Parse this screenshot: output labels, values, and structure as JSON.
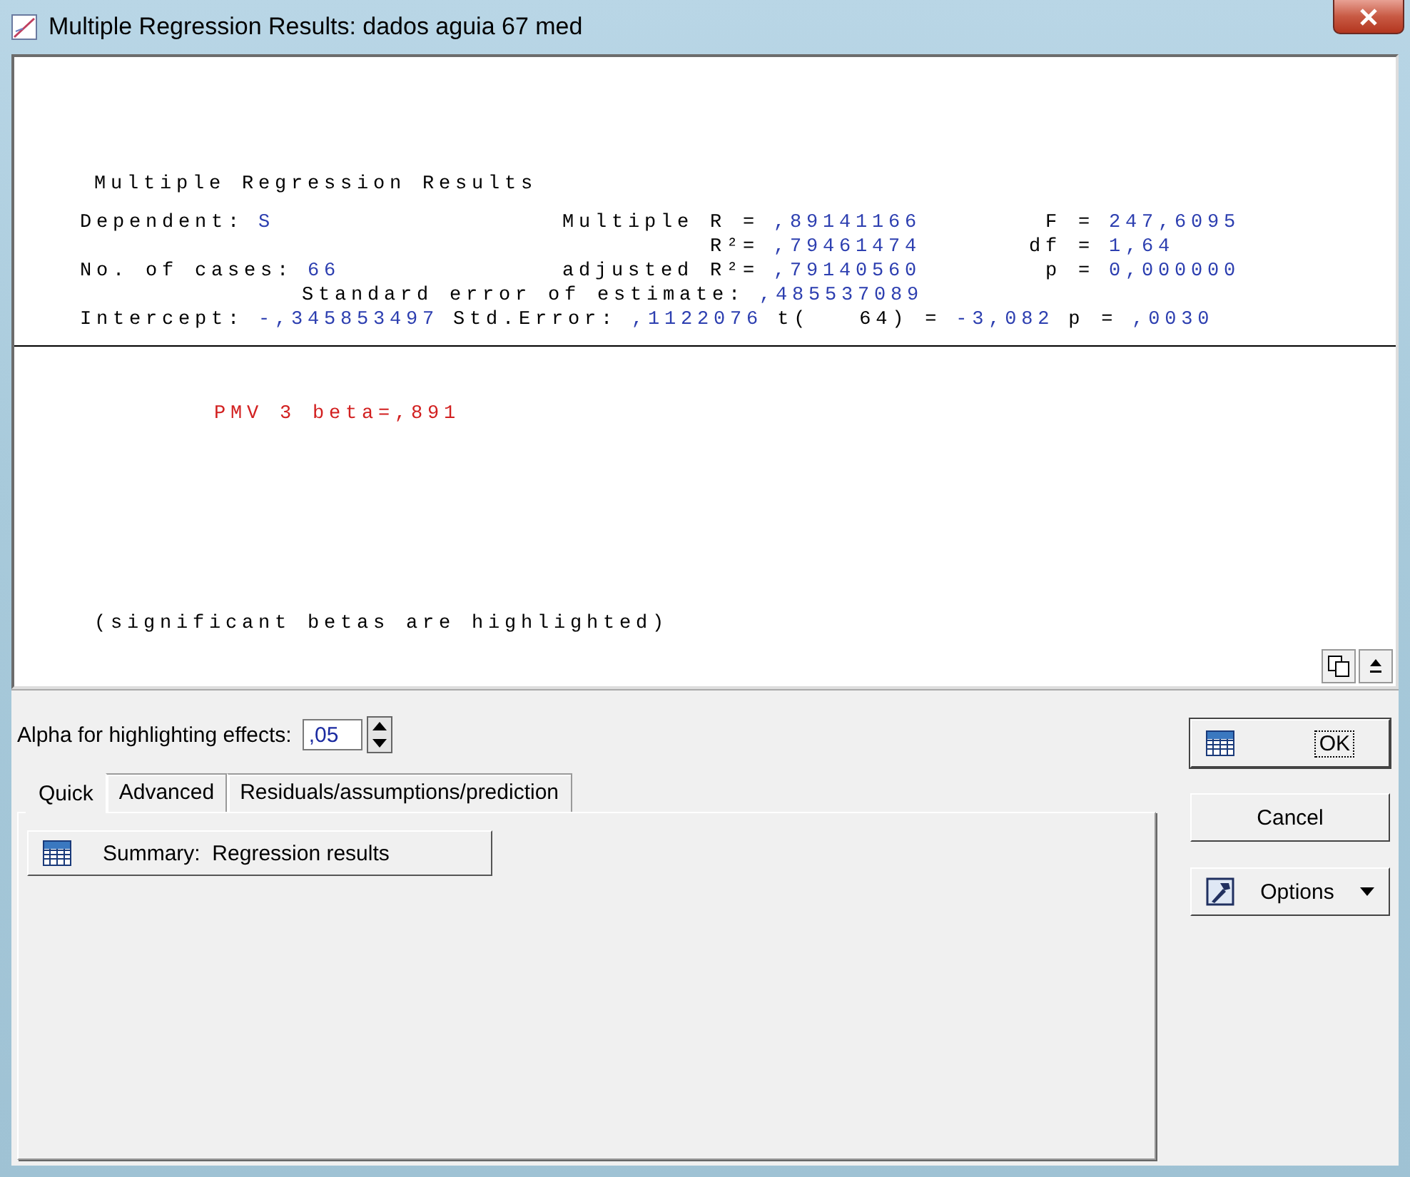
{
  "window": {
    "title": "Multiple Regression Results: dados aguia 67 med"
  },
  "results": {
    "heading": "Multiple Regression Results",
    "stats": [
      {
        "label": "Dependent:",
        "value": "S"
      },
      {
        "label": "Multiple R =",
        "value": ",89141166"
      },
      {
        "label": "F =",
        "value": "247,6095"
      },
      {
        "label": "R²=",
        "value": ",79461474"
      },
      {
        "label": "df =",
        "value": "1,64"
      },
      {
        "label": "No. of cases:",
        "value": "66"
      },
      {
        "label": "adjusted R²=",
        "value": ",79140560"
      },
      {
        "label": "p =",
        "value": "0,000000"
      },
      {
        "label": "Standard error of estimate:",
        "value": ",485537089"
      }
    ],
    "intercept": [
      {
        "kind": "label",
        "text": "Intercept:"
      },
      {
        "kind": "value",
        "text": "-,345853497"
      },
      {
        "kind": "label",
        "text": "Std.Error:"
      },
      {
        "kind": "value",
        "text": ",1122076"
      },
      {
        "kind": "label",
        "text": "t(   64) ="
      },
      {
        "kind": "value",
        "text": "-3,082"
      },
      {
        "kind": "label",
        "text": "p ="
      },
      {
        "kind": "value",
        "text": ",0030"
      }
    ],
    "betas": [
      {
        "text": "PMV 3 beta=,891",
        "significant": true
      }
    ],
    "note": "(significant betas are highlighted)"
  },
  "alpha": {
    "label": "Alpha for highlighting effects:",
    "value": ",05"
  },
  "tabs": [
    {
      "label": "Quick",
      "selected": true
    },
    {
      "label": "Advanced",
      "selected": false
    },
    {
      "label": "Residuals/assumptions/prediction",
      "selected": false
    }
  ],
  "quick_buttons": [
    {
      "label": "Summary:  Regression results"
    }
  ],
  "side_buttons": [
    {
      "kind": "ok",
      "label": "OK"
    },
    {
      "kind": "cancel",
      "label": "Cancel"
    },
    {
      "kind": "options",
      "label": "Options"
    }
  ]
}
